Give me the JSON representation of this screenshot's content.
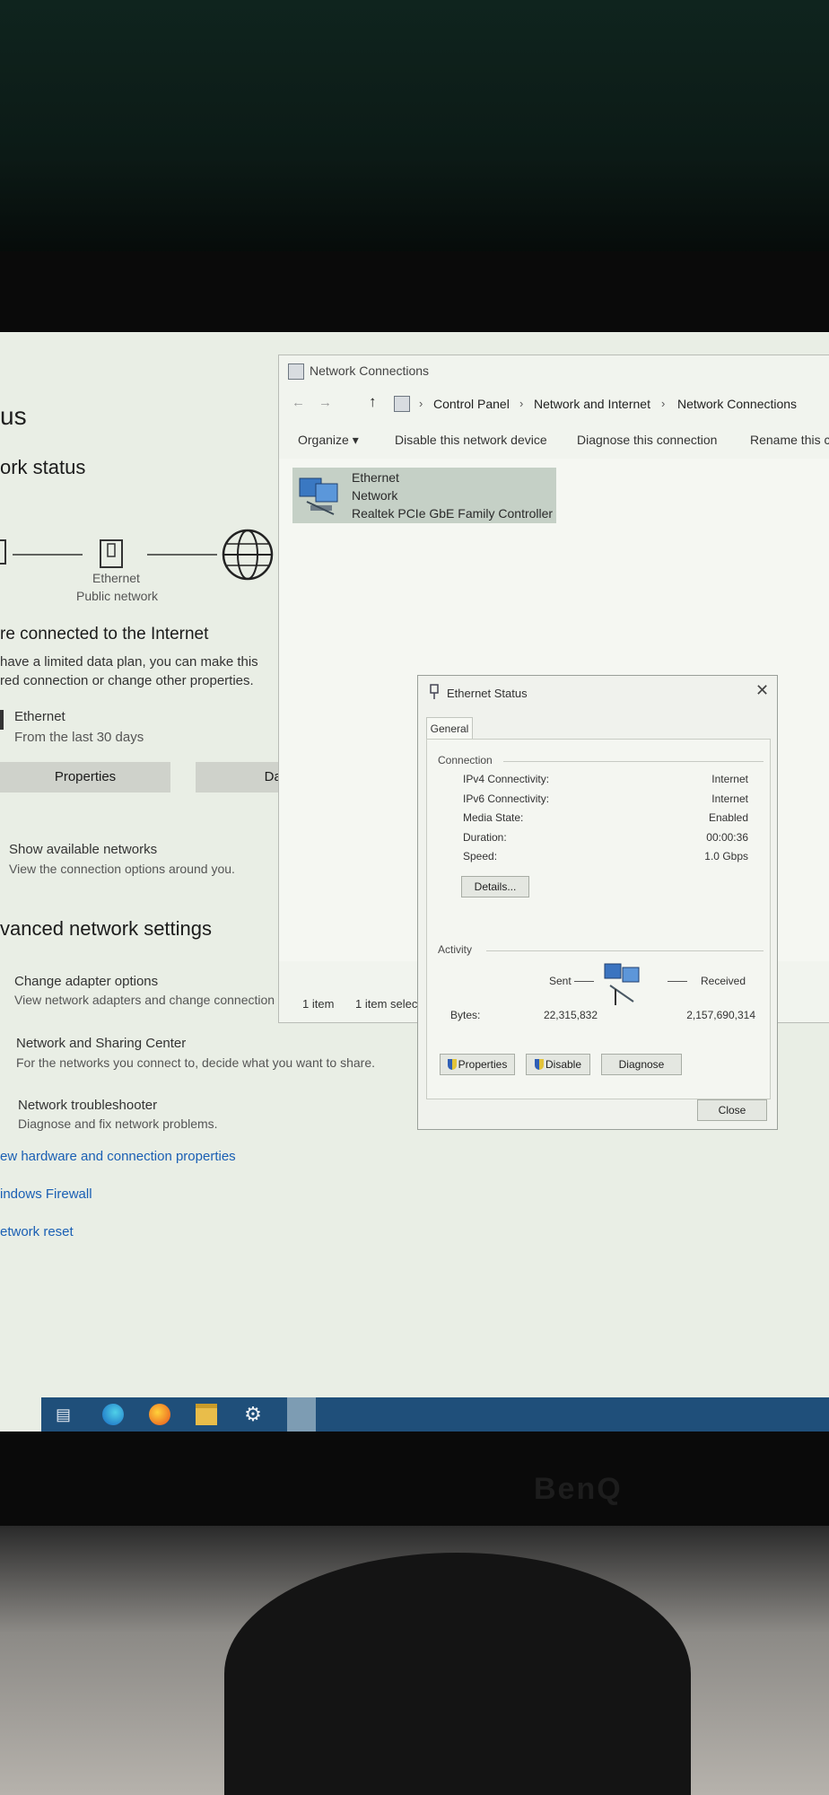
{
  "settings": {
    "title_partial": "us",
    "network_status_partial": "ork status",
    "diagram": {
      "adapter_label": "Ethernet",
      "network_label": "Public network"
    },
    "connected_partial": "re connected to the Internet",
    "limited_plan_line1": "have a limited data plan, you can make this",
    "limited_plan_line2": "red connection or change other properties.",
    "ethernet_name": "Ethernet",
    "ethernet_sub": "From the last 30 days",
    "properties_button": "Properties",
    "data_usage_button_partial": "Dat",
    "show_networks_title": "Show available networks",
    "show_networks_sub": "View the connection options around you.",
    "advanced_partial": "vanced network settings",
    "change_adapter_title": "Change adapter options",
    "change_adapter_sub": "View network adapters and change connection",
    "sharing_center_title": "Network and Sharing Center",
    "sharing_center_sub": "For the networks you connect to, decide what you want to share.",
    "troubleshooter_title": "Network troubleshooter",
    "troubleshooter_sub": "Diagnose and fix network problems.",
    "link_hardware": "ew hardware and connection properties",
    "link_firewall": "indows Firewall",
    "link_reset": "etwork reset"
  },
  "network_connections": {
    "title": "Network Connections",
    "breadcrumb": [
      "Control Panel",
      "Network and Internet",
      "Network Connections"
    ],
    "toolbar": {
      "organize": "Organize ▾",
      "disable": "Disable this network device",
      "diagnose": "Diagnose this connection",
      "rename": "Rename this c"
    },
    "adapter": {
      "name": "Ethernet",
      "network": "Network",
      "device": "Realtek PCIe GbE Family Controller"
    },
    "status_count": "1 item",
    "status_selected": "1 item selec"
  },
  "ethernet_status": {
    "title": "Ethernet Status",
    "tab": "General",
    "connection_group": "Connection",
    "rows": [
      {
        "label": "IPv4 Connectivity:",
        "value": "Internet"
      },
      {
        "label": "IPv6 Connectivity:",
        "value": "Internet"
      },
      {
        "label": "Media State:",
        "value": "Enabled"
      },
      {
        "label": "Duration:",
        "value": "00:00:36"
      },
      {
        "label": "Speed:",
        "value": "1.0 Gbps"
      }
    ],
    "details_button": "Details...",
    "activity_group": "Activity",
    "sent_label": "Sent",
    "received_label": "Received",
    "bytes_label": "Bytes:",
    "bytes_sent": "22,315,832",
    "bytes_received": "2,157,690,314",
    "properties_button": "Properties",
    "disable_button": "Disable",
    "diagnose_button": "Diagnose",
    "close_button": "Close"
  },
  "monitor": {
    "brand": "BenQ"
  }
}
